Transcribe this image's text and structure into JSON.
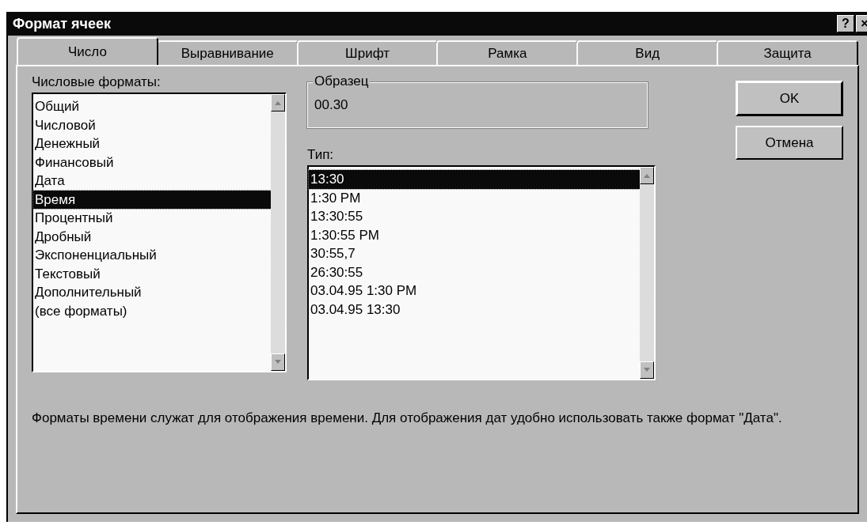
{
  "window": {
    "title": "Формат ячеек",
    "title_buttons": [
      "?",
      "×"
    ]
  },
  "tabs": [
    {
      "label": "Число",
      "selected": true
    },
    {
      "label": "Выравнивание",
      "selected": false
    },
    {
      "label": "Шрифт",
      "selected": false
    },
    {
      "label": "Рамка",
      "selected": false
    },
    {
      "label": "Вид",
      "selected": false
    },
    {
      "label": "Защита",
      "selected": false
    }
  ],
  "categories": {
    "label": "Числовые форматы:",
    "items": [
      {
        "label": "Общий",
        "selected": false
      },
      {
        "label": "Числовой",
        "selected": false
      },
      {
        "label": "Денежный",
        "selected": false
      },
      {
        "label": "Финансовый",
        "selected": false
      },
      {
        "label": "Дата",
        "selected": false
      },
      {
        "label": "Время",
        "selected": true
      },
      {
        "label": "Процентный",
        "selected": false
      },
      {
        "label": "Дробный",
        "selected": false
      },
      {
        "label": "Экспоненциальный",
        "selected": false
      },
      {
        "label": "Текстовый",
        "selected": false
      },
      {
        "label": "Дополнительный",
        "selected": false
      },
      {
        "label": "(все форматы)",
        "selected": false
      }
    ]
  },
  "sample": {
    "label": "Образец",
    "value": "00.30"
  },
  "type": {
    "label": "Тип:",
    "items": [
      {
        "label": "13:30",
        "selected": true
      },
      {
        "label": "1:30 PM",
        "selected": false
      },
      {
        "label": "13:30:55",
        "selected": false
      },
      {
        "label": "1:30:55 PM",
        "selected": false
      },
      {
        "label": "30:55,7",
        "selected": false
      },
      {
        "label": "26:30:55",
        "selected": false
      },
      {
        "label": "03.04.95 1:30 PM",
        "selected": false
      },
      {
        "label": "03.04.95 13:30",
        "selected": false
      }
    ]
  },
  "buttons": [
    "OK",
    "Отмена"
  ],
  "description": "Форматы времени служат для отображения времени. Для отображения дат удобно использовать также формат \"Дата\"."
}
